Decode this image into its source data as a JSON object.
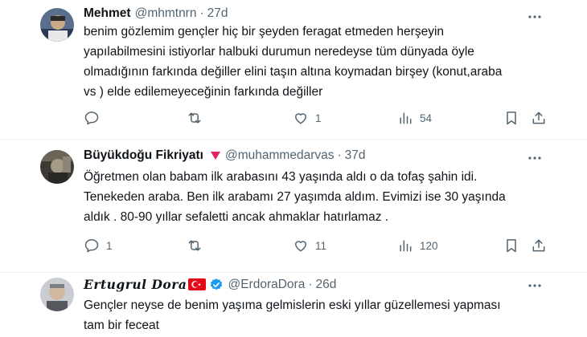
{
  "tweets": [
    {
      "name": "Mehmet",
      "handle": "@mhmtnrn",
      "dot": "·",
      "time": "27d",
      "lines": [
        "benim gözlemim gençler hiç bir şeyden feragat etmeden herşeyin",
        "yapılabilmesini istiyorlar halbuki durumun neredeyse tüm dünyada öyle",
        "olmadığının farkında değiller elini taşın altına koymadan birşey (konut,araba",
        "vs ) elde edilemeyeceğinin farkında değiller"
      ],
      "replies": "",
      "retweets": "",
      "likes": "1",
      "views": "54"
    },
    {
      "name": "Büyükdoğu Fikriyatı",
      "handle": "@muhammedarvas",
      "dot": "·",
      "time": "37d",
      "lines": [
        "Öğretmen olan babam ilk arabasını 43 yaşında aldı o da tofaş şahin idi.",
        "Tenekeden araba. Ben ilk arabamı 27 yaşımda aldım. Evimizi ise 30 yaşında",
        "aldık . 80-90 yıllar sefaletti ancak ahmaklar hatırlamaz ."
      ],
      "replies": "1",
      "retweets": "",
      "likes": "11",
      "views": "120"
    },
    {
      "name": "Ertugrul Dora",
      "handle": "@ErdoraDora",
      "dot": "·",
      "time": "26d",
      "lines": [
        "Gençler neyse de benim yaşıma gelmislerin eski yıllar güzellemesi yapması",
        "tam bir feceat"
      ]
    }
  ],
  "colors": {
    "text": "#0f1419",
    "muted": "#536471",
    "verified": "#1d9bf0",
    "flag": "#e30a17",
    "heart_mark": "#e0245e"
  },
  "icons": [
    "more-icon",
    "reply-icon",
    "retweet-icon",
    "like-icon",
    "views-icon",
    "bookmark-icon",
    "share-icon",
    "verified-icon",
    "turkey-flag-icon"
  ]
}
